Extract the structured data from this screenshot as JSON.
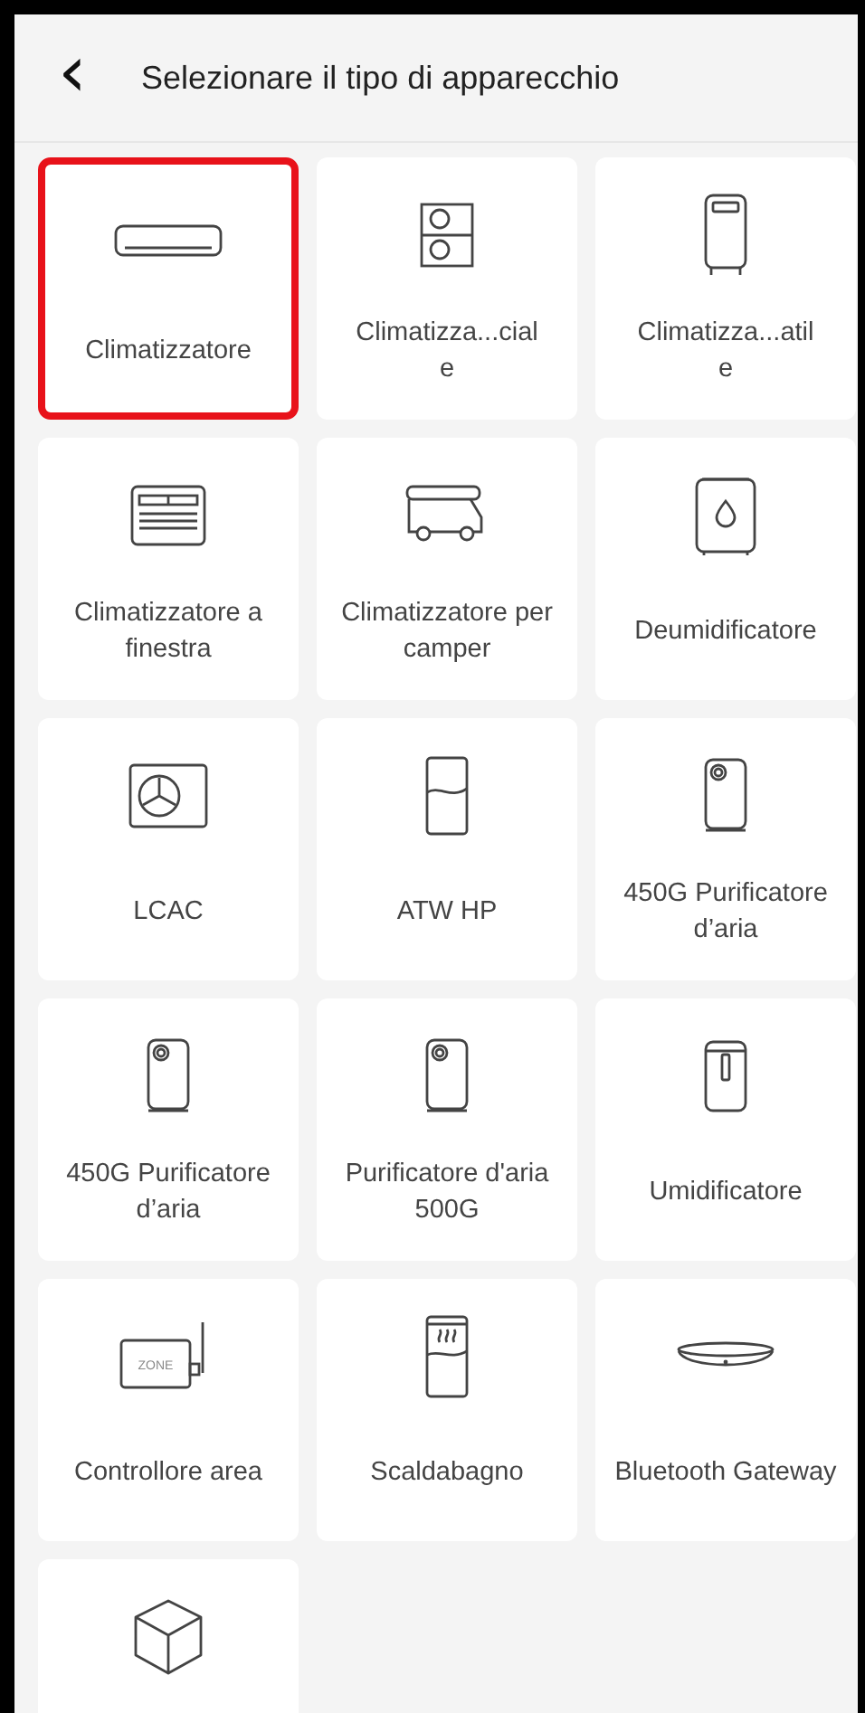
{
  "header": {
    "back": "‹",
    "title": "Selezionare il tipo di apparecchio"
  },
  "devices": [
    {
      "kind": "split",
      "label": "Climatizzatore",
      "selected": true
    },
    {
      "kind": "dualfan",
      "label": "Climatizza...cial\ne",
      "selected": false
    },
    {
      "kind": "portable",
      "label": "Climatizza...atil\ne",
      "selected": false
    },
    {
      "kind": "window",
      "label": "Climatizzatore a finestra",
      "selected": false
    },
    {
      "kind": "camper",
      "label": "Climatizzatore per camper",
      "selected": false
    },
    {
      "kind": "dehumidifier",
      "label": "Deumidificatore",
      "selected": false
    },
    {
      "kind": "fanbox",
      "label": "LCAC",
      "selected": false
    },
    {
      "kind": "tank",
      "label": "ATW HP",
      "selected": false
    },
    {
      "kind": "purifier",
      "label": "450G Purificatore d’aria",
      "selected": false
    },
    {
      "kind": "purifier",
      "label": "450G Purificatore d’aria",
      "selected": false
    },
    {
      "kind": "purifier",
      "label": "Purificatore d'aria 500G",
      "selected": false
    },
    {
      "kind": "humidifier",
      "label": "Umidificatore",
      "selected": false
    },
    {
      "kind": "zone",
      "label": "Controllore area",
      "icon_text": "ZONE",
      "selected": false
    },
    {
      "kind": "heater",
      "label": "Scaldabagno",
      "selected": false
    },
    {
      "kind": "gateway",
      "label": "Bluetooth Gateway",
      "selected": false
    },
    {
      "kind": "cube",
      "selected": false
    }
  ]
}
